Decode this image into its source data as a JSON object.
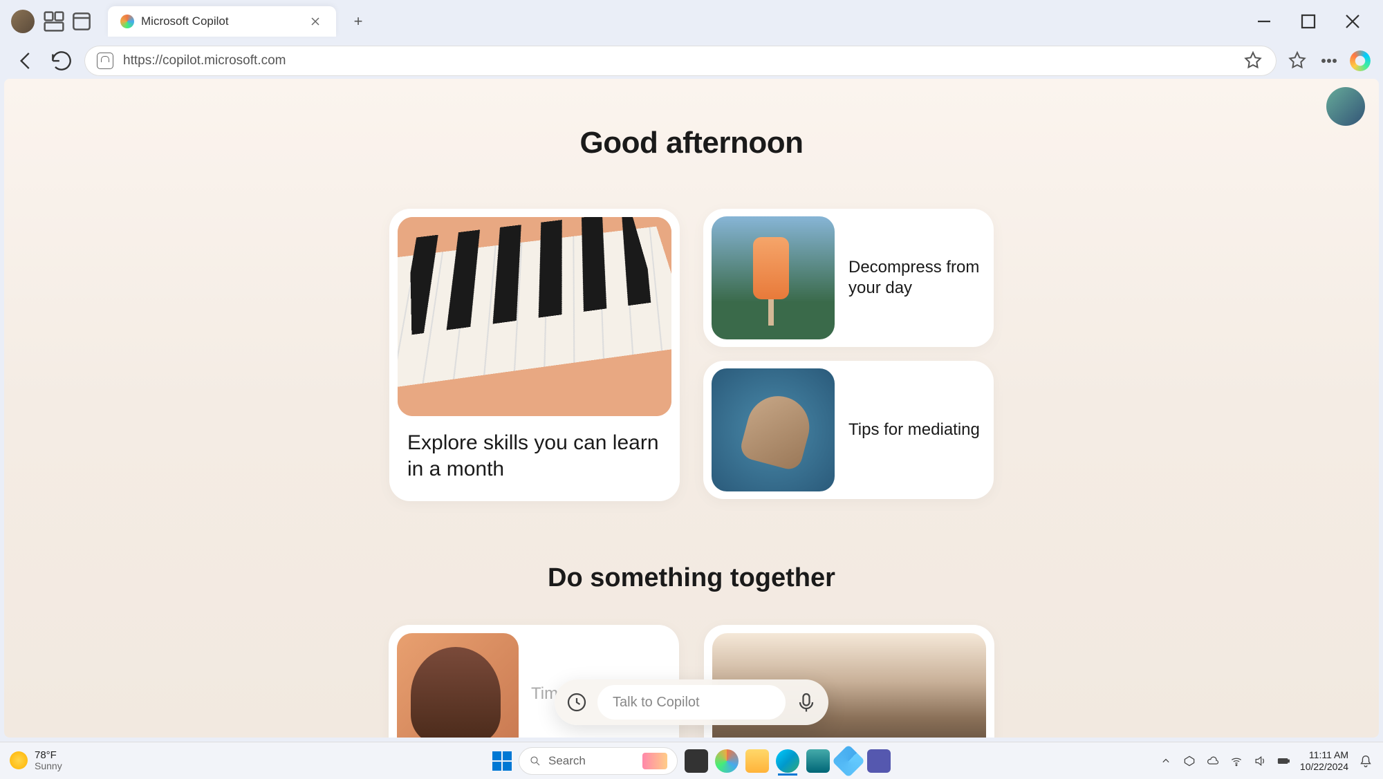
{
  "browser": {
    "tab_title": "Microsoft Copilot",
    "url": "https://copilot.microsoft.com"
  },
  "page": {
    "greeting": "Good afternoon",
    "cards": {
      "big": "Explore skills you can learn in a month",
      "small1": "Decompress from your day",
      "small2": "Tips for mediating"
    },
    "section2": "Do something together",
    "row2_hint": "Tim",
    "input_placeholder": "Talk to Copilot"
  },
  "taskbar": {
    "temp": "78°F",
    "condition": "Sunny",
    "search_placeholder": "Search",
    "time": "11:11 AM",
    "date": "10/22/2024"
  }
}
